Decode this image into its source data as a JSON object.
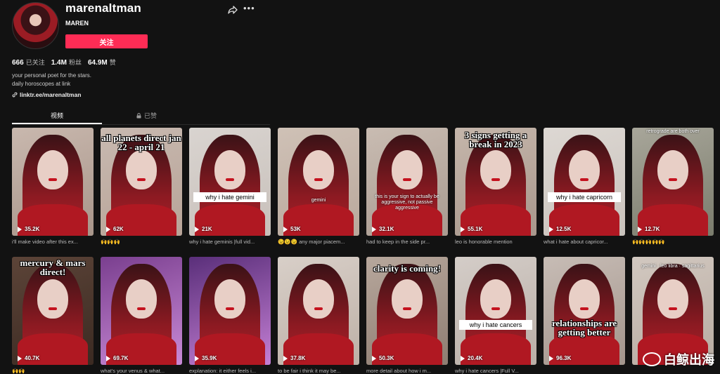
{
  "profile": {
    "username": "marenaltman",
    "nickname": "MAREN",
    "follow_label": "关注",
    "following_count": "666",
    "following_label": "已关注",
    "followers_count": "1.4M",
    "followers_label": "粉丝",
    "likes_count": "64.9M",
    "likes_label": "赞",
    "bio_line1": "your personal poet for the stars.",
    "bio_line2": "daily horoscopes at link",
    "link": "linktr.ee/marenaltman"
  },
  "tabs": {
    "videos": "视频",
    "liked": "已赞"
  },
  "videos": [
    {
      "views": "35.2K",
      "caption": "i'll make video after this ex...",
      "overlay": ""
    },
    {
      "views": "62K",
      "caption": "🙌🙌🙌",
      "overlay": "all planets direct jan 22 - april 21"
    },
    {
      "views": "21K",
      "caption": "why i hate geminis |full vid...",
      "overlay": "why i hate gemini"
    },
    {
      "views": "53K",
      "caption": "😉😉😉 any major piacem...",
      "overlay": "gemini"
    },
    {
      "views": "32.1K",
      "caption": "had to keep in the side pr...",
      "overlay": "this is your sign to actually be aggressive, not passive aggressive"
    },
    {
      "views": "55.1K",
      "caption": "leo is honorable mention",
      "overlay": "3 signs getting a break in 2023"
    },
    {
      "views": "12.5K",
      "caption": "what i hate about capricor...",
      "overlay": "why i hate capricorn"
    },
    {
      "views": "12.7K",
      "caption": "🙌🙌🙌🙌🙌",
      "overlay": "retrograde are both over"
    },
    {
      "views": "40.7K",
      "caption": "🙌🙌",
      "overlay": "mercury & mars direct!"
    },
    {
      "views": "69.7K",
      "caption": "what's your venus & what...",
      "overlay": ""
    },
    {
      "views": "35.9K",
      "caption": "explanation: it either feels i...",
      "overlay": ""
    },
    {
      "views": "37.8K",
      "caption": "to be fair i think it may be...",
      "overlay": ""
    },
    {
      "views": "50.3K",
      "caption": "more detail about how i m...",
      "overlay": "clarity is coming!"
    },
    {
      "views": "20.4K",
      "caption": "why i hate cancers |Full V...",
      "overlay": "why i hate cancers"
    },
    {
      "views": "96.3K",
      "caption": "",
      "overlay": "relationships are getting better"
    },
    {
      "views": "",
      "caption": "",
      "overlay": "gemini · leo libra · sagittarius"
    }
  ],
  "watermark": "白鲸出海",
  "colors": {
    "accent": "#fe2c55",
    "background": "#121212"
  }
}
